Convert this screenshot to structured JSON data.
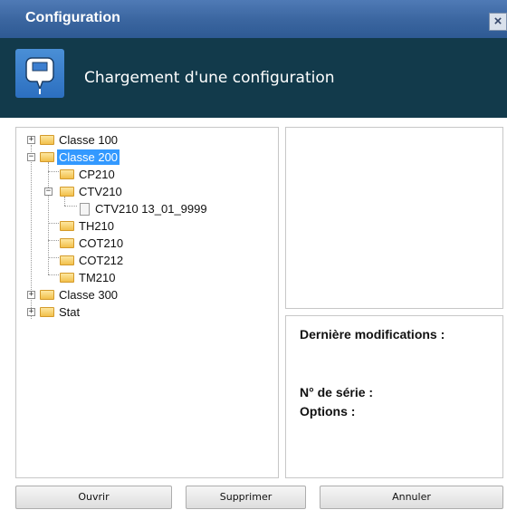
{
  "window": {
    "title": "Configuration",
    "close_label": "×"
  },
  "header": {
    "subtitle": "Chargement d'une configuration",
    "icon": "device-icon"
  },
  "tree": {
    "items": [
      {
        "label": "Classe 100",
        "expander": "+",
        "selected": false
      },
      {
        "label": "Classe 200",
        "expander": "−",
        "selected": true
      },
      {
        "label": "CP210"
      },
      {
        "label": "CTV210",
        "expander": "−"
      },
      {
        "label": "CTV210 13_01_9999",
        "icon": "file-icon"
      },
      {
        "label": "TH210"
      },
      {
        "label": "COT210"
      },
      {
        "label": "COT212"
      },
      {
        "label": "TM210"
      },
      {
        "label": "Classe 300",
        "expander": "+"
      },
      {
        "label": "Stat",
        "expander": "+"
      }
    ]
  },
  "info": {
    "last_modified_label": "Dernière modifications :",
    "serial_label": "N° de série :",
    "options_label": "Options :"
  },
  "buttons": {
    "open": "Ouvrir",
    "delete": "Supprimer",
    "cancel": "Annuler"
  },
  "colors": {
    "titlebar": "#3a659f",
    "header_band": "#123a4b",
    "selection": "#3399ff"
  }
}
